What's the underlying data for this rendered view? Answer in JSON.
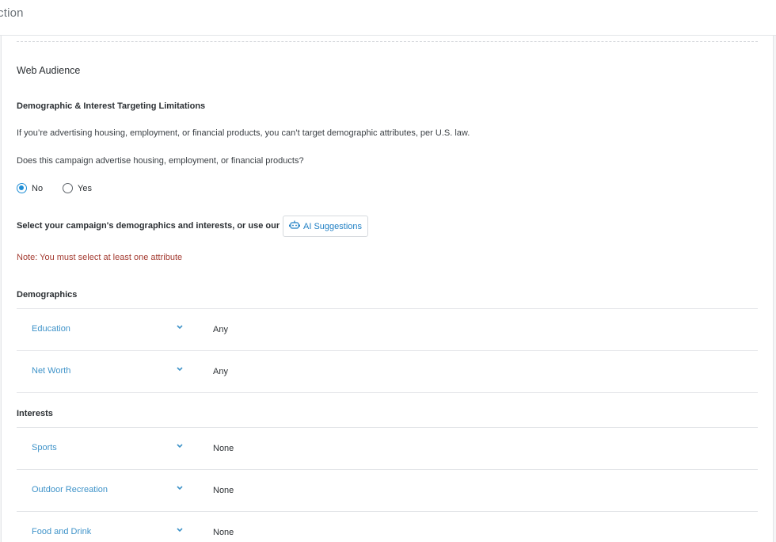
{
  "header": {
    "title": "ction"
  },
  "section": {
    "title": "Web Audience",
    "limitations_heading": "Demographic & Interest Targeting Limitations",
    "limitations_text": "If you’re advertising housing, employment, or financial products, you can’t target demographic attributes, per U.S. law.",
    "question": "Does this campaign advertise housing, employment, or financial products?",
    "options": [
      {
        "label": "No",
        "selected": true
      },
      {
        "label": "Yes",
        "selected": false
      }
    ],
    "select_prompt": "Select your campaign's demographics and interests, or use our",
    "ai_button_label": "AI Suggestions",
    "note": "Note: You must select at least one attribute"
  },
  "demographics": {
    "label": "Demographics",
    "rows": [
      {
        "label": "Education",
        "value": "Any"
      },
      {
        "label": "Net Worth",
        "value": "Any"
      }
    ]
  },
  "interests": {
    "label": "Interests",
    "rows": [
      {
        "label": "Sports",
        "value": "None"
      },
      {
        "label": "Outdoor Recreation",
        "value": "None"
      },
      {
        "label": "Food and Drink",
        "value": "None"
      }
    ]
  },
  "colors": {
    "accent": "#1f8ed6",
    "link": "#3f93c9",
    "warning": "#a33a30"
  },
  "icons": {
    "ai_button": "robot-icon",
    "row_toggle": "chevron-down-icon"
  }
}
